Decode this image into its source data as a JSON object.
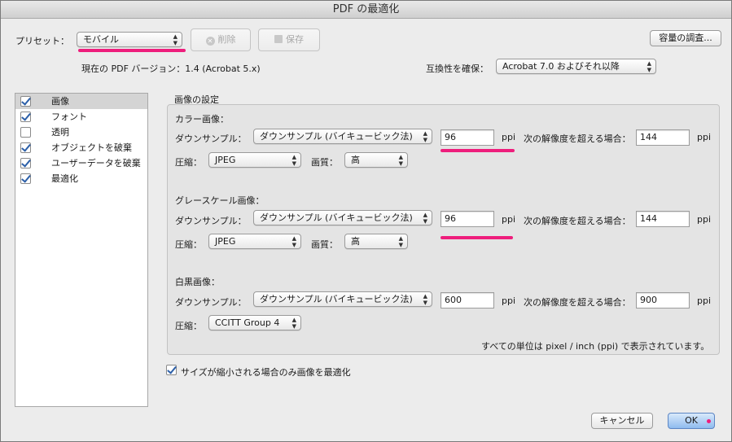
{
  "window": {
    "title": "PDF の最適化"
  },
  "preset": {
    "label": "プリセット：",
    "value": "モバイル",
    "delete_label": "削除",
    "save_label": "保存",
    "audit_label": "容量の調査..."
  },
  "version": {
    "current_label": "現在の PDF バージョン：1.4 (Acrobat 5.x)",
    "compat_label": "互換性を確保：",
    "compat_value": "Acrobat 7.0 およびそれ以降"
  },
  "sidebar": {
    "items": [
      {
        "label": "画像",
        "checked": true
      },
      {
        "label": "フォント",
        "checked": true
      },
      {
        "label": "透明",
        "checked": false
      },
      {
        "label": "オブジェクトを破棄",
        "checked": true
      },
      {
        "label": "ユーザーデータを破棄",
        "checked": true
      },
      {
        "label": "最適化",
        "checked": true
      }
    ]
  },
  "image_settings": {
    "title": "画像の設定",
    "downsample_label": "ダウンサンプル：",
    "compression_label": "圧縮：",
    "quality_label": "画質：",
    "ppi": "ppi",
    "above_label": "次の解像度を超える場合：",
    "color": {
      "title": "カラー画像：",
      "method": "ダウンサンプル (バイキュービック法)",
      "ppi_value": "96",
      "above_value": "144",
      "compression": "JPEG",
      "quality": "高"
    },
    "gray": {
      "title": "グレースケール画像：",
      "method": "ダウンサンプル (バイキュービック法)",
      "ppi_value": "96",
      "above_value": "144",
      "compression": "JPEG",
      "quality": "高"
    },
    "mono": {
      "title": "白黒画像：",
      "method": "ダウンサンプル (バイキュービック法)",
      "ppi_value": "600",
      "above_value": "900",
      "compression": "CCITT Group 4"
    },
    "units_note": "すべての単位は pixel / inch (ppi) で表示されています。"
  },
  "optimize_only_label": "サイズが縮小される場合のみ画像を最適化",
  "buttons": {
    "cancel": "キャンセル",
    "ok": "OK"
  },
  "colors": {
    "highlight": "#ee1e7c",
    "accent": "#2c5fa8"
  }
}
